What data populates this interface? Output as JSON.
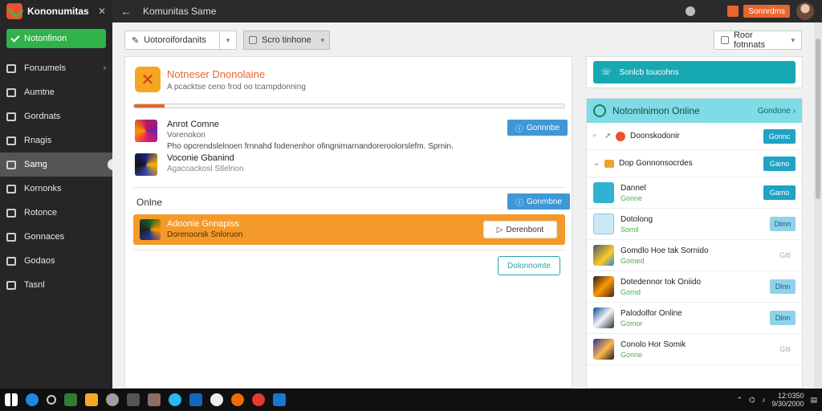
{
  "app": {
    "name": "Kononumitas",
    "title": "Komunitas Same"
  },
  "sidebar": {
    "active_label": "Notonfinon",
    "items": [
      {
        "label": "Foruumels",
        "icon": "users-icon",
        "chevron": true
      },
      {
        "label": "Aumtne",
        "icon": "person-icon"
      },
      {
        "label": "Gordnats",
        "icon": "chat-icon"
      },
      {
        "label": "Rnagis",
        "icon": "image-icon"
      },
      {
        "label": "Samg",
        "icon": "bookmark-icon",
        "selected": true
      },
      {
        "label": "Kornonks",
        "icon": "mail-icon"
      },
      {
        "label": "Rotonce",
        "icon": "calendar-icon"
      },
      {
        "label": "Gonnaces",
        "icon": "grid-icon"
      },
      {
        "label": "Godaos",
        "icon": "folder-icon"
      },
      {
        "label": "Tasnl",
        "icon": "exit-icon"
      }
    ]
  },
  "topbar": {
    "orange_btn": "Sonnrdms"
  },
  "toolbar": {
    "field1": "Uotoroifordanits",
    "field2": "Scro tinhone",
    "field3": "Roor fotnnats"
  },
  "left_panel": {
    "hero_title": "Notneser Dnonolaine",
    "hero_sub": "A pcacktse ceno frod oo tcarnpdonning",
    "progress": 0.07,
    "row1": {
      "title": "Anrot Comne",
      "sub": "Vorenokon",
      "desc": "Pho opcrendslelnoen frnnahd fodenenhor ofingnimarnandoreroolorslefm. Sprnin.",
      "button": "Gonnnbe"
    },
    "row2": {
      "title": "Voconie Gbanind",
      "sub": "Agacoackosl Stlelrion"
    },
    "section": "Onlne",
    "section_button": "Gonmbne",
    "highlight": {
      "title": "Adoonie Gnnapiss",
      "sub": "Dorenoorsk Snloruon",
      "button": "Derenbont"
    },
    "outline_button": "Dolonnomte"
  },
  "right_panel": {
    "banner": "Sonlcb toucohns",
    "header_title": "Notomlnimon Online",
    "header_link": "Gondone",
    "rows": [
      {
        "name": "Doonskodonir",
        "button": "Gonnc",
        "kind": "simple1"
      },
      {
        "name": "Dop Gonnonsocrdes",
        "button": "Gamo",
        "kind": "simple2"
      },
      {
        "name": "Dannel",
        "sub": "Gonne",
        "button": "Gamo",
        "thumb": "t-teal"
      },
      {
        "name": "Dotolong",
        "sub": "Somil",
        "button": "Dlmn",
        "thumb": "t-light",
        "style": "light"
      },
      {
        "name": "Gomdlo Hoe tak Sornido",
        "sub": "Gomed",
        "button": "Gltl",
        "thumb": "t-pic1",
        "style": "ghost"
      },
      {
        "name": "Dotedennor tok Oniido",
        "sub": "Gornd",
        "button": "Dlnn",
        "thumb": "t-pic2",
        "style": "light"
      },
      {
        "name": "Palodolfor Online",
        "sub": "Gomor",
        "button": "Dlnn",
        "thumb": "t-pic3",
        "style": "light"
      },
      {
        "name": "Conolo Hor Somik",
        "sub": "Gonne",
        "button": "Gltl",
        "thumb": "t-pic4",
        "style": "ghost"
      }
    ]
  },
  "taskbar": {
    "time": "12:0350",
    "date": "9/30/2000"
  }
}
